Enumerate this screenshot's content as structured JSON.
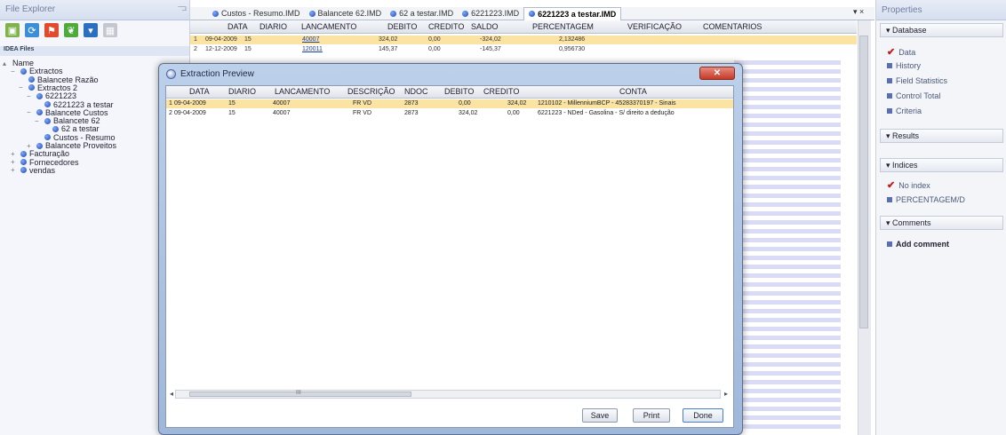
{
  "file_explorer": {
    "title": "File Explorer",
    "pin": "⫎",
    "toolbar_icons": [
      "folder-icon",
      "refresh-icon",
      "flag-icon",
      "leaf-icon",
      "filter-icon",
      "grid-icon"
    ],
    "idea_files_label": "IDEA Files",
    "tree": [
      {
        "label": "Name",
        "indent": 0,
        "expander": "▴",
        "icon": false
      },
      {
        "label": "Extractos",
        "indent": 1,
        "expander": "−",
        "icon": true
      },
      {
        "label": "Balancete Razão",
        "indent": 2,
        "expander": "",
        "icon": true
      },
      {
        "label": "Extractos 2",
        "indent": 2,
        "expander": "−",
        "icon": true
      },
      {
        "label": "6221223",
        "indent": 3,
        "expander": "−",
        "icon": true
      },
      {
        "label": "6221223 a testar",
        "indent": 4,
        "expander": "",
        "icon": true
      },
      {
        "label": "Balancete Custos",
        "indent": 3,
        "expander": "−",
        "icon": true
      },
      {
        "label": "Balancete 62",
        "indent": 4,
        "expander": "−",
        "icon": true
      },
      {
        "label": "62 a testar",
        "indent": 5,
        "expander": "",
        "icon": true
      },
      {
        "label": "Custos - Resumo",
        "indent": 4,
        "expander": "",
        "icon": true
      },
      {
        "label": "Balancete Proveitos",
        "indent": 3,
        "expander": "+",
        "icon": true
      },
      {
        "label": "Facturação",
        "indent": 1,
        "expander": "+",
        "icon": true
      },
      {
        "label": "Fornecedores",
        "indent": 1,
        "expander": "+",
        "icon": true
      },
      {
        "label": "vendas",
        "indent": 1,
        "expander": "+",
        "icon": true
      }
    ]
  },
  "tabs": [
    {
      "label": "Custos - Resumo.IMD",
      "active": false
    },
    {
      "label": "Balancete 62.IMD",
      "active": false
    },
    {
      "label": "62 a testar.IMD",
      "active": false
    },
    {
      "label": "6221223.IMD",
      "active": false
    },
    {
      "label": "6221223 a testar.IMD",
      "active": true
    }
  ],
  "tab_controls": "▾ ×",
  "grid": {
    "headers": [
      "DATA",
      "DIARIO",
      "LANCAMENTO",
      "DEBITO",
      "CREDITO",
      "SALDO",
      "PERCENTAGEM",
      "VERIFICAÇÃO",
      "COMENTARIOS"
    ],
    "rows": [
      [
        "1",
        "09-04-2009",
        "15",
        "40007",
        "324,02",
        "0,00",
        "-324,02",
        "2,132486",
        "",
        ""
      ],
      [
        "2",
        "12-12-2009",
        "15",
        "120011",
        "145,37",
        "0,00",
        "-145,37",
        "0,956730",
        "",
        ""
      ]
    ]
  },
  "properties": {
    "title": "Properties",
    "database_label": "Database",
    "database_items": [
      "Data",
      "History",
      "Field Statistics",
      "Control Total",
      "Criteria"
    ],
    "results_label": "Results",
    "indices_label": "Indices",
    "indices_items": [
      "No index",
      "PERCENTAGEM/D"
    ],
    "comments_label": "Comments",
    "add_comment": "Add comment"
  },
  "dialog": {
    "title": "Extraction Preview",
    "close": "✕",
    "headers": [
      "DATA",
      "DIARIO",
      "LANCAMENTO",
      "DESCRIÇÃO",
      "NDOC",
      "DEBITO",
      "CREDITO",
      "CONTA"
    ],
    "rows": [
      [
        "1",
        "09-04-2009",
        "15",
        "40007",
        "FR VD",
        "2873",
        "0,00",
        "324,02",
        "1210102 - MillenniumBCP - 45283370197 - Sinais"
      ],
      [
        "2",
        "09-04-2009",
        "15",
        "40007",
        "FR VD",
        "2873",
        "324,02",
        "0,00",
        "6221223 - NDed - Gasolina - S/ direito a dedução"
      ]
    ],
    "scroll_left": "◂",
    "scroll_right": "▸",
    "scroll_grip": "III",
    "buttons": {
      "save": "Save",
      "print": "Print",
      "done": "Done"
    }
  },
  "colors": {
    "selected_row": "#fbe3a4",
    "accent_blue": "#2145a8",
    "close_red": "#c53a28",
    "check_red": "#c31919"
  }
}
